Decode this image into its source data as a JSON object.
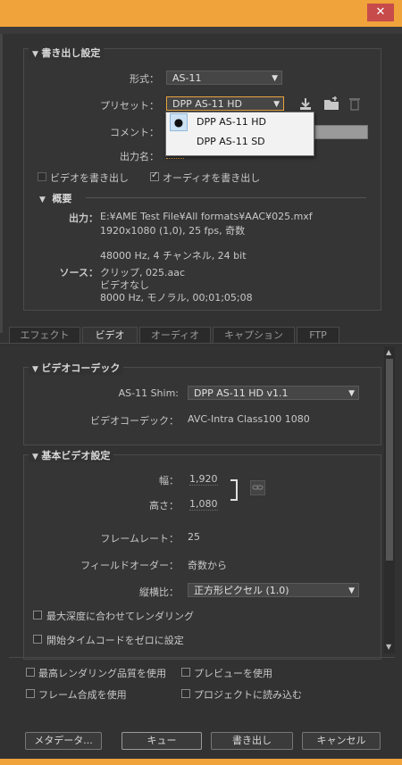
{
  "window": {
    "close_glyph": "✕"
  },
  "export_settings": {
    "title": "書き出し設定",
    "format_label": "形式：",
    "format_value": "AS-11",
    "preset_label": "プリセット：",
    "preset_value": "DPP AS-11 HD",
    "preset_options": [
      {
        "label": "DPP AS-11 HD",
        "selected": true
      },
      {
        "label": "DPP AS-11 SD",
        "selected": false
      }
    ],
    "comment_label": "コメント：",
    "output_label": "出力名：",
    "export_video_label": "ビデオを書き出し",
    "export_audio_label": "オーディオを書き出し",
    "summary_title": "概要",
    "summary": {
      "output_label": "出力：",
      "output_lines": [
        "E:¥AME Test File¥All formats¥AAC¥025.mxf",
        "1920x1080 (1,0), 25 fps, 奇数",
        "48000 Hz, 4 チャンネル, 24 bit"
      ],
      "source_label": "ソース：",
      "source_lines": [
        "クリップ, 025.aac",
        "ビデオなし",
        "8000 Hz, モノラル, 00;01;05;08"
      ]
    }
  },
  "tabs": [
    "エフェクト",
    "ビデオ",
    "オーディオ",
    "キャプション",
    "FTP"
  ],
  "active_tab": "ビデオ",
  "video_codec": {
    "title": "ビデオコーデック",
    "shim_label": "AS-11 Shim:",
    "shim_value": "DPP AS-11 HD v1.1",
    "codec_label": "ビデオコーデック：",
    "codec_value": "AVC-Intra Class100 1080"
  },
  "basic_video": {
    "title": "基本ビデオ設定",
    "width_label": "幅：",
    "width_value": "1,920",
    "height_label": "高さ：",
    "height_value": "1,080",
    "frame_rate_label": "フレームレート：",
    "frame_rate_value": "25",
    "field_order_label": "フィールドオーダー：",
    "field_order_value": "奇数から",
    "aspect_label": "縦横比：",
    "aspect_value": "正方形ピクセル (1.0)",
    "max_depth_label": "最大深度に合わせてレンダリング",
    "start_tc_label": "開始タイムコードをゼロに設定"
  },
  "bottom_options": {
    "max_quality": "最高レンダリング品質を使用",
    "use_preview": "プレビューを使用",
    "frame_blend": "フレーム合成を使用",
    "import_project": "プロジェクトに読み込む"
  },
  "buttons": {
    "metadata": "メタデータ...",
    "queue": "キュー",
    "export": "書き出し",
    "cancel": "キャンセル"
  }
}
